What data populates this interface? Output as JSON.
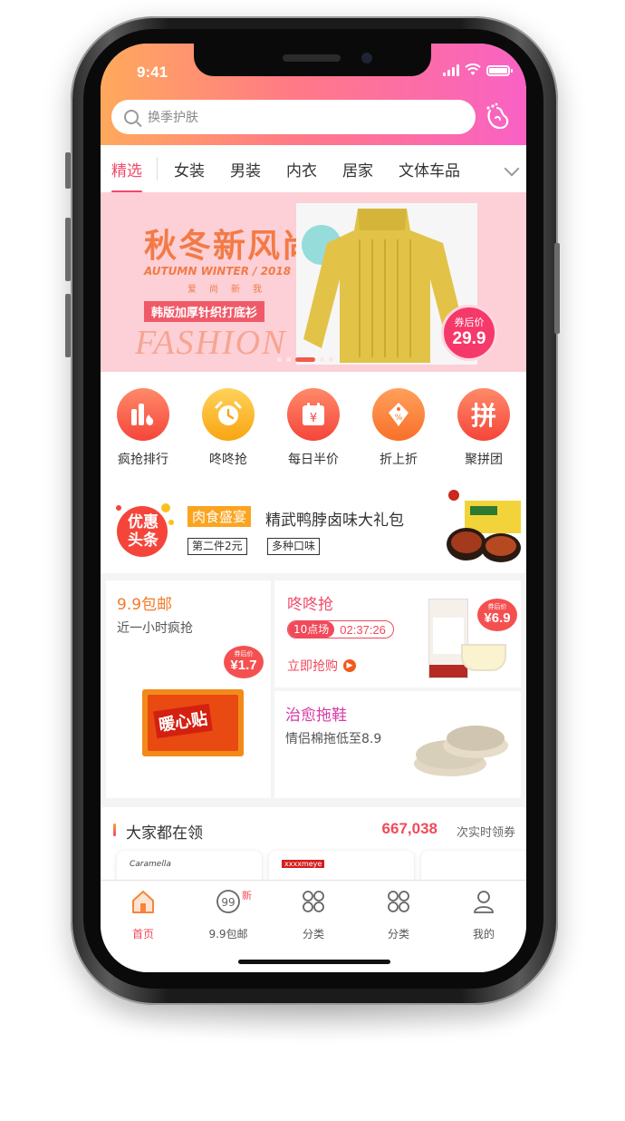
{
  "status_bar": {
    "time": "9:41"
  },
  "search": {
    "placeholder": "换季护肤"
  },
  "tabs": [
    {
      "label": "精选",
      "active": true
    },
    {
      "label": "女装"
    },
    {
      "label": "男装"
    },
    {
      "label": "内衣"
    },
    {
      "label": "居家"
    },
    {
      "label": "文体车品"
    }
  ],
  "banner": {
    "title": "秋冬新风尚",
    "subtitle": "AUTUMN WINTER / 2018",
    "subtitle2": "爱尚新我",
    "tag": "韩版加厚针织打底衫",
    "fashion": "FASHION",
    "badge_label": "券后价",
    "badge_price": "29.9",
    "active_dot": 2,
    "dot_count": 5
  },
  "quick_icons": [
    {
      "label": "疯抢排行",
      "icon": "ranking-fire-icon",
      "color": "#f5574a"
    },
    {
      "label": "咚咚抢",
      "icon": "alarm-clock-icon",
      "color": "#fbb01e"
    },
    {
      "label": "每日半价",
      "icon": "calendar-yen-icon",
      "color": "#f5574a"
    },
    {
      "label": "折上折",
      "icon": "discount-tag-icon",
      "color": "#fa7a30"
    },
    {
      "label": "聚拼团",
      "icon": "group-buy-icon",
      "color": "#f5574a",
      "glyph": "拼"
    }
  ],
  "headline": {
    "logo_text": "优惠头条",
    "tag": "肉食盛宴",
    "title": "精武鸭脖卤味大礼包",
    "chips": [
      "第二件2元",
      "多种口味"
    ]
  },
  "promo": {
    "left": {
      "title": "9.9包邮",
      "subtitle": "近一小时疯抢",
      "price_label": "券后价",
      "price": "¥1.7",
      "product_text": "暖心贴"
    },
    "top_right": {
      "title": "咚咚抢",
      "timer_label": "10点场",
      "timer_value": "02:37:26",
      "link": "立即抢购",
      "price_label": "券后价",
      "price": "¥6.9"
    },
    "bottom_right": {
      "title": "治愈拖鞋",
      "subtitle": "情侣棉拖低至8.9"
    }
  },
  "collect": {
    "title": "大家都在领",
    "count": "667,038",
    "suffix": "次实时领券",
    "card_brands": [
      "Caramella",
      "xxxxmeye",
      ""
    ]
  },
  "bottom_nav": [
    {
      "label": "首页",
      "icon": "home-icon",
      "active": true
    },
    {
      "label": "9.9包邮",
      "icon": "nine-nine-icon",
      "badge": "新"
    },
    {
      "label": "分类",
      "icon": "grid-icon"
    },
    {
      "label": "分类",
      "icon": "grid-icon"
    },
    {
      "label": "我的",
      "icon": "user-icon"
    }
  ],
  "colors": {
    "accent": "#f04a5a",
    "header_gradient": [
      "#ffa95c",
      "#ff7a86",
      "#f961c4"
    ]
  }
}
